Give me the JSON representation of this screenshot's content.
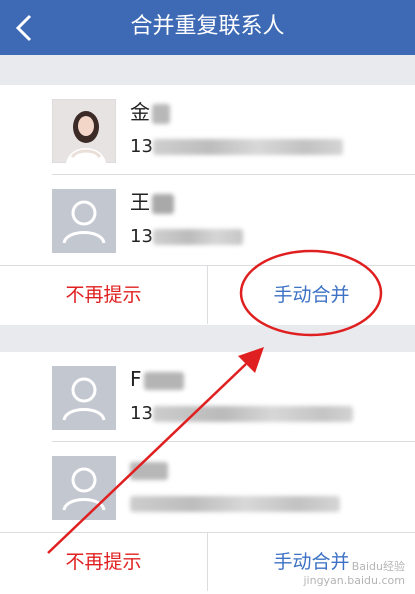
{
  "header": {
    "title": "合并重复联系人",
    "back_icon": "chevron-left-icon",
    "background_color": "#3e6ab5"
  },
  "groups": [
    {
      "contacts": [
        {
          "name_visible": "金",
          "phone_prefix": "13",
          "avatar": "photo"
        },
        {
          "name_visible": "王",
          "phone_prefix": "13",
          "avatar": "default-person-icon"
        }
      ],
      "actions": {
        "dismiss_label": "不再提示",
        "merge_label": "手动合并"
      }
    },
    {
      "contacts": [
        {
          "name_visible": "F",
          "phone_prefix": "13",
          "avatar": "default-person-icon"
        },
        {
          "name_visible": "",
          "phone_prefix": "",
          "avatar": "default-person-icon"
        }
      ],
      "actions": {
        "dismiss_label": "不再提示",
        "merge_label": "手动合并"
      }
    }
  ],
  "annotation": {
    "color": "#e02020",
    "highlight": "merge-button-group-1"
  },
  "watermark": {
    "line1": "Baidu经验",
    "line2": "jingyan.baidu.com"
  },
  "colors": {
    "dismiss": "#e02020",
    "merge": "#3d72c5"
  }
}
